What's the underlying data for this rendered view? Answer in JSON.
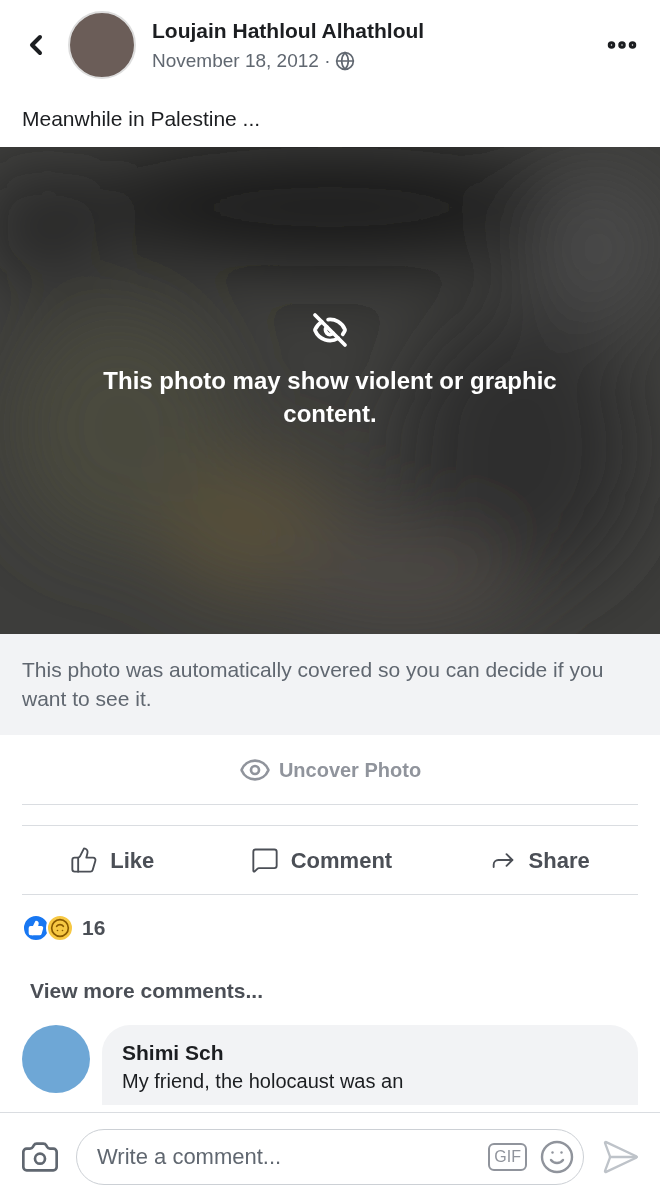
{
  "header": {
    "author": "Loujain Hathloul Alhathloul",
    "date": "November 18, 2012 ·"
  },
  "caption": "Meanwhile in Palestine ...",
  "photo": {
    "kind": "picture",
    "warning": "This photo may show violent or graphic content."
  },
  "notice": "This photo was automatically covered so you can decide if you want to see it.",
  "uncover_button": "Uncover Photo",
  "actions": [
    {
      "kind": "like",
      "label": "Like"
    },
    {
      "kind": "comment",
      "label": "Comment"
    },
    {
      "kind": "share",
      "label": "Share"
    }
  ],
  "reactions": {
    "count": "16"
  },
  "view_more": "View more comments...",
  "comments": [
    {
      "author": "Shimi Sch",
      "text": "My friend, the holocaust was an"
    }
  ],
  "composer": {
    "placeholder": "Write a comment...",
    "gif": "GIF"
  }
}
